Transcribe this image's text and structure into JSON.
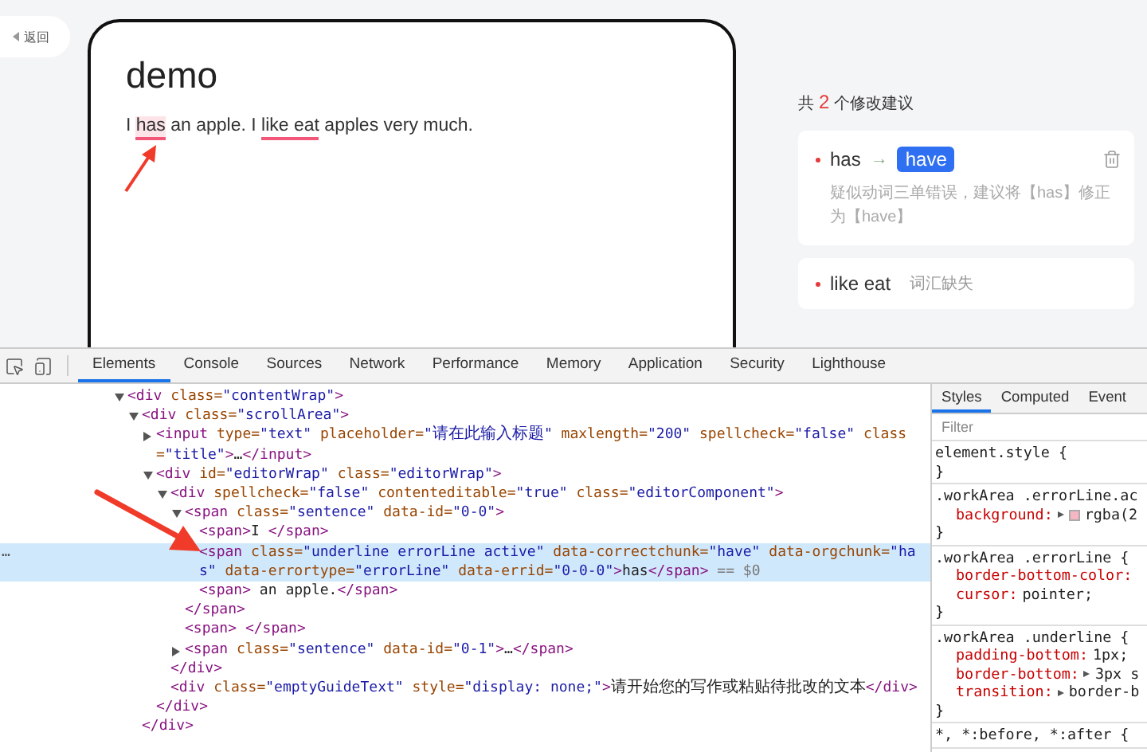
{
  "back_button": {
    "label": "返回"
  },
  "editor": {
    "title": "demo",
    "segments": [
      {
        "kind": "plain",
        "text": "I "
      },
      {
        "kind": "error",
        "text": "has",
        "active": true
      },
      {
        "kind": "plain",
        "text": " an apple. I "
      },
      {
        "kind": "error",
        "text": "like eat",
        "active": false
      },
      {
        "kind": "plain",
        "text": " apples very much."
      }
    ]
  },
  "suggestions": {
    "prefix": "共",
    "count": "2",
    "suffix": "个修改建议",
    "items": [
      {
        "kind": "replace",
        "original": "has",
        "arrow": "→",
        "replacement": "have",
        "description": "疑似动词三单错误，建议将【has】修正为【have】",
        "expanded": true
      },
      {
        "kind": "missing",
        "original": "like eat",
        "type_label": "词汇缺失",
        "expanded": false
      }
    ]
  },
  "devtools": {
    "tabs": [
      {
        "label": "Elements",
        "selected": true
      },
      {
        "label": "Console",
        "selected": false
      },
      {
        "label": "Sources",
        "selected": false
      },
      {
        "label": "Network",
        "selected": false
      },
      {
        "label": "Performance",
        "selected": false
      },
      {
        "label": "Memory",
        "selected": false
      },
      {
        "label": "Application",
        "selected": false
      },
      {
        "label": "Security",
        "selected": false
      },
      {
        "label": "Lighthouse",
        "selected": false
      }
    ],
    "dom": [
      {
        "open": "<div class=\"contentWrap\">",
        "expanded": true,
        "selected": false,
        "children": [
          {
            "open": "<div class=\"scrollArea\">",
            "expanded": true,
            "selected": false,
            "close": "</div>",
            "children": [
              {
                "open": "<input type=\"text\" placeholder=\"请在此输入标题\" maxlength=\"200\" spellcheck=\"false\" class=\"title\">…</input>",
                "expanded": false,
                "selected": false
              },
              {
                "open": "<div id=\"editorWrap\" class=\"editorWrap\">",
                "expanded": true,
                "selected": false,
                "close": "</div>",
                "children": [
                  {
                    "open": "<div spellcheck=\"false\" contenteditable=\"true\" class=\"editorComponent\">",
                    "expanded": true,
                    "selected": false,
                    "close": "</div>",
                    "children": [
                      {
                        "open": "<span class=\"sentence\" data-id=\"0-0\">",
                        "expanded": true,
                        "selected": false,
                        "close": "</span>",
                        "children": [
                          {
                            "open": "<span>I </span>",
                            "selected": false
                          },
                          {
                            "open": "<span class=\"underline errorLine active\" data-correctchunk=\"have\" data-orgchunk=\"has\" data-errortype=\"errorLine\" data-errid=\"0-0-0\">has</span>",
                            "selected": true,
                            "gutter": "…",
                            "suffix": "== $0"
                          },
                          {
                            "open": "<span> an apple.</span>",
                            "selected": false
                          }
                        ]
                      },
                      {
                        "open": "<span> </span>",
                        "selected": false
                      },
                      {
                        "open": "<span class=\"sentence\" data-id=\"0-1\">…</span>",
                        "expanded": false,
                        "selected": false
                      }
                    ]
                  },
                  {
                    "open": "<div class=\"emptyGuideText\" style=\"display: none;\">请开始您的写作或粘贴待批改的文本</div>",
                    "selected": false
                  }
                ]
              }
            ]
          }
        ]
      }
    ],
    "side_tabs": [
      {
        "label": "Styles",
        "selected": true
      },
      {
        "label": "Computed",
        "selected": false
      },
      {
        "label": "Event",
        "selected": false
      }
    ],
    "filter": {
      "placeholder": "Filter"
    },
    "rules": [
      {
        "selector": "element.style {",
        "close": "}"
      },
      {
        "selector": ".workArea .errorLine.ac",
        "close": "}",
        "properties": [
          {
            "name": "background:",
            "value": "rgba(2",
            "expandable": true,
            "swatch": true
          }
        ]
      },
      {
        "selector": ".workArea .errorLine {",
        "close": "}",
        "properties": [
          {
            "name": "border-bottom-color:",
            "expandable": false,
            "swatch": false
          },
          {
            "name": "cursor:",
            "value": "pointer;",
            "expandable": false,
            "swatch": false
          }
        ]
      },
      {
        "selector": ".workArea .underline {",
        "close": "}",
        "properties": [
          {
            "name": "padding-bottom:",
            "value": "1px;",
            "expandable": false,
            "swatch": false
          },
          {
            "name": "border-bottom:",
            "value": "3px s",
            "expandable": true,
            "swatch": false
          },
          {
            "name": "transition:",
            "value": "border-b",
            "expandable": true,
            "swatch": false
          }
        ]
      },
      {
        "selector": "*, *:before, *:after {"
      }
    ]
  }
}
